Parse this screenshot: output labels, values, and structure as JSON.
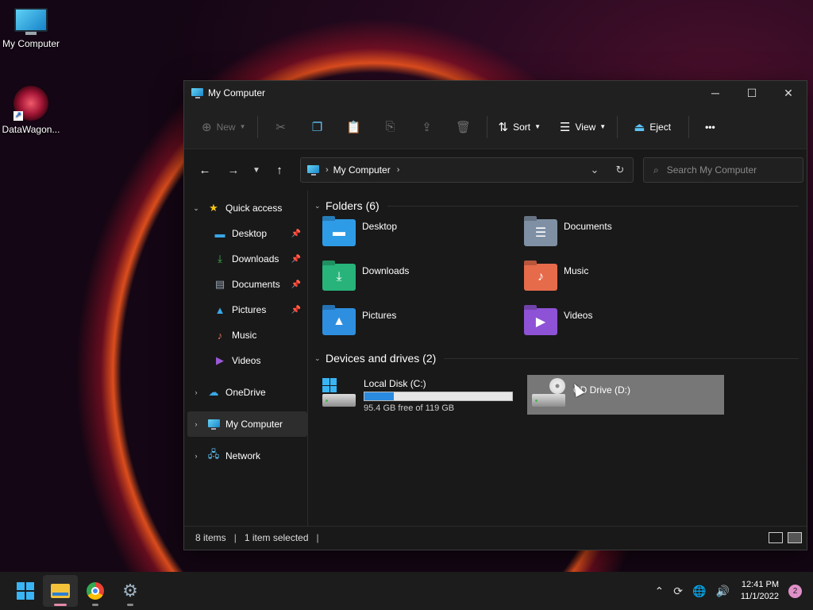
{
  "desktop": {
    "icons": [
      {
        "label": "My Computer"
      },
      {
        "label": "DataWagon..."
      }
    ]
  },
  "window": {
    "title": "My Computer",
    "controls": {
      "minimize": "─",
      "maximize": "☐",
      "close": "✕"
    }
  },
  "commandbar": {
    "new_label": "New",
    "sort_label": "Sort",
    "view_label": "View",
    "eject_label": "Eject",
    "more_label": "•••"
  },
  "navbar": {
    "breadcrumb": "My Computer",
    "search_placeholder": "Search My Computer"
  },
  "sidebar": {
    "quick_access": "Quick access",
    "quick_items": [
      {
        "label": "Desktop",
        "pinned": true,
        "color": "#3aa7e8"
      },
      {
        "label": "Downloads",
        "pinned": true,
        "color": "#3fb950"
      },
      {
        "label": "Documents",
        "pinned": true,
        "color": "#9aa7b6"
      },
      {
        "label": "Pictures",
        "pinned": true,
        "color": "#3aa7e8"
      },
      {
        "label": "Music",
        "pinned": false,
        "color": "#e2725b"
      },
      {
        "label": "Videos",
        "pinned": false,
        "color": "#9b59d8"
      }
    ],
    "onedrive": "OneDrive",
    "my_computer": "My Computer",
    "network": "Network"
  },
  "content": {
    "folders_header": "Folders (6)",
    "folders": [
      {
        "label": "Desktop",
        "color": "#2e9be6",
        "icon": "desktop"
      },
      {
        "label": "Documents",
        "color": "#7f90a5",
        "icon": "documents"
      },
      {
        "label": "Downloads",
        "color": "#27b37a",
        "icon": "downloads"
      },
      {
        "label": "Music",
        "color": "#e66b4b",
        "icon": "music"
      },
      {
        "label": "Pictures",
        "color": "#2e8fe0",
        "icon": "pictures"
      },
      {
        "label": "Videos",
        "color": "#8e52d6",
        "icon": "videos"
      }
    ],
    "devices_header": "Devices and drives (2)",
    "drives": [
      {
        "label": "Local Disk (C:)",
        "free_text": "95.4 GB free of 119 GB",
        "used_fraction": 0.2
      },
      {
        "label": "CD Drive (D:)"
      }
    ]
  },
  "statusbar": {
    "items": "8 items",
    "selected": "1 item selected"
  },
  "taskbar": {
    "time": "12:41 PM",
    "date": "11/1/2022",
    "notifications": "2"
  }
}
